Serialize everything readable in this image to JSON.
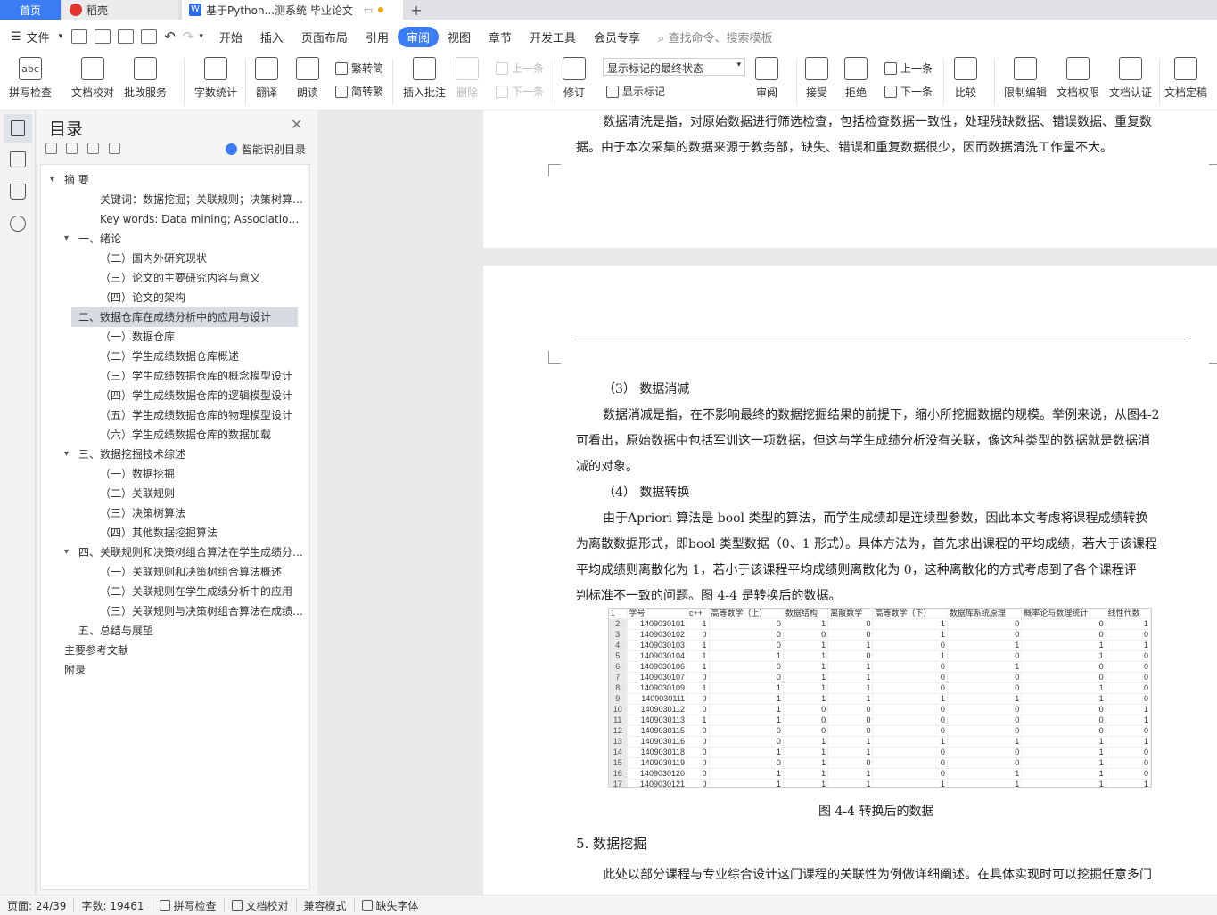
{
  "tabs": {
    "home": "首页",
    "daoke": "稻壳",
    "doc": "基于Python...测系统 毕业论文"
  },
  "menu": {
    "file": "文件",
    "items": [
      "开始",
      "插入",
      "页面布局",
      "引用",
      "审阅",
      "视图",
      "章节",
      "开发工具",
      "会员专享"
    ],
    "active": "审阅",
    "search_placeholder": "查找命令、搜索模板"
  },
  "ribbon": {
    "spellcheck": "拼写检查",
    "proofread": "文档校对",
    "correction_service": "批改服务",
    "word_count": "字数统计",
    "translate": "翻译",
    "read_aloud": "朗读",
    "trad_to_simp_a": "繁转简",
    "trad_to_simp_b": "简转繁",
    "insert_comment": "插入批注",
    "delete": "删除",
    "prev_comment": "上一条",
    "next_comment": "下一条",
    "revise": "修订",
    "track_state": "显示标记的最终状态",
    "show_markup": "显示标记",
    "review": "审阅",
    "accept": "接受",
    "reject": "拒绝",
    "prev_change": "上一条",
    "next_change": "下一条",
    "compare": "比较",
    "restrict_edit": "限制编辑",
    "doc_permission": "文档权限",
    "doc_cert": "文档认证",
    "doc_finalize": "文档定稿"
  },
  "toc": {
    "title": "目录",
    "smart": "智能识别目录",
    "items": [
      {
        "text": "摘  要",
        "level": 0,
        "arrow": true
      },
      {
        "text": "关键词：数据挖掘；关联规则；决策树算法；成绩分析",
        "level": 2
      },
      {
        "text": "Key words: Data mining; Association rules; Decision tree",
        "level": 2
      },
      {
        "text": "一、绪论",
        "level": 1,
        "arrow": true
      },
      {
        "text": "（二）国内外研究现状",
        "level": 2
      },
      {
        "text": "（三）论文的主要研究内容与意义",
        "level": 2
      },
      {
        "text": "（四）论文的架构",
        "level": 2
      },
      {
        "text": "二、数据仓库在成绩分析中的应用与设计",
        "level": 1,
        "arrow": true,
        "selected": true
      },
      {
        "text": "（一）数据仓库",
        "level": 2
      },
      {
        "text": "（二）学生成绩数据仓库概述",
        "level": 2
      },
      {
        "text": "（三）学生成绩数据仓库的概念模型设计",
        "level": 2
      },
      {
        "text": "（四）学生成绩数据仓库的逻辑模型设计",
        "level": 2
      },
      {
        "text": "（五）学生成绩数据仓库的物理模型设计",
        "level": 2
      },
      {
        "text": "（六）学生成绩数据仓库的数据加载",
        "level": 2
      },
      {
        "text": "三、数据挖掘技术综述",
        "level": 1,
        "arrow": true
      },
      {
        "text": "（一）数据挖掘",
        "level": 2
      },
      {
        "text": "（二）关联规则",
        "level": 2
      },
      {
        "text": "（三）决策树算法",
        "level": 2
      },
      {
        "text": "（四）其他数据挖掘算法",
        "level": 2
      },
      {
        "text": "四、关联规则和决策树组合算法在学生成绩分析中的应用",
        "level": 1,
        "arrow": true
      },
      {
        "text": "（一）关联规则和决策树组合算法概述",
        "level": 2
      },
      {
        "text": "（二）关联规则在学生成绩分析中的应用",
        "level": 2
      },
      {
        "text": "（三）关联规则与决策树组合算法在成绩分析中的应用",
        "level": 2
      },
      {
        "text": "五、总结与展望",
        "level": 1
      },
      {
        "text": "主要参考文献",
        "level": 0
      },
      {
        "text": "附录",
        "level": 0
      }
    ]
  },
  "doc": {
    "p1_line1": "数据清洗是指，对原始数据进行筛选检查，包括检查数据一致性，处理残缺数据、错误数据、重复数",
    "p1_line2": "据。由于本次采集的数据来源于教务部，缺失、错误和重复数据很少，因而数据清洗工作量不大。",
    "h3": "（3） 数据消减",
    "p2_line1": "数据消减是指，在不影响最终的数据挖掘结果的前提下，缩小所挖掘数据的规模。举例来说，从图4-2",
    "p2_line2": "可看出，原始数据中包括军训这一项数据，但这与学生成绩分析没有关联，像这种类型的数据就是数据消",
    "p2_line3": "减的对象。",
    "h4": "（4） 数据转换",
    "p3_line1": "由于Apriori 算法是 bool 类型的算法，而学生成绩却是连续型参数，因此本文考虑将课程成绩转换",
    "p3_line2": "为离散数据形式，即bool 类型数据（0、1 形式）。具体方法为，首先求出课程的平均成绩，若大于该课程",
    "p3_line3": "平均成绩则离散化为 1，若小于该课程平均成绩则离散化为 0，这种离散化的方式考虑到了各个课程评",
    "p3_line4": "判标准不一致的问题。图 4-4 是转换后的数据。",
    "caption": "图 4-4 转换后的数据",
    "h5": "5. 数据挖掘",
    "p4_line1": "此处以部分课程与专业综合设计这门课程的关联性为例做详细阐述。在具体实现时可以挖掘任意多门"
  },
  "figure": {
    "headers": [
      "学号",
      "c++",
      "高等数学（上）",
      "数据结构",
      "离散数学",
      "高等数学（下）",
      "数据库系统原理",
      "概率论与数理统计",
      "线性代数"
    ],
    "rows": [
      [
        "1409030101",
        "1",
        "0",
        "1",
        "0",
        "1",
        "0",
        "0",
        "1"
      ],
      [
        "1409030102",
        "0",
        "0",
        "0",
        "0",
        "1",
        "0",
        "0",
        "0"
      ],
      [
        "1409030103",
        "1",
        "0",
        "1",
        "1",
        "0",
        "1",
        "1",
        "1"
      ],
      [
        "1409030104",
        "1",
        "1",
        "1",
        "0",
        "1",
        "0",
        "1",
        "0"
      ],
      [
        "1409030106",
        "1",
        "0",
        "1",
        "1",
        "0",
        "1",
        "0",
        "0"
      ],
      [
        "1409030107",
        "0",
        "0",
        "1",
        "1",
        "0",
        "0",
        "0",
        "0"
      ],
      [
        "1409030109",
        "1",
        "1",
        "1",
        "1",
        "0",
        "0",
        "1",
        "0"
      ],
      [
        "1409030111",
        "0",
        "1",
        "1",
        "1",
        "1",
        "1",
        "1",
        "0"
      ],
      [
        "1409030112",
        "0",
        "1",
        "0",
        "0",
        "0",
        "0",
        "0",
        "1"
      ],
      [
        "1409030113",
        "1",
        "1",
        "0",
        "0",
        "0",
        "0",
        "0",
        "1"
      ],
      [
        "1409030115",
        "0",
        "0",
        "0",
        "0",
        "0",
        "0",
        "0",
        "0"
      ],
      [
        "1409030116",
        "0",
        "0",
        "1",
        "1",
        "1",
        "1",
        "1",
        "1"
      ],
      [
        "1409030118",
        "0",
        "1",
        "1",
        "1",
        "0",
        "0",
        "1",
        "0"
      ],
      [
        "1409030119",
        "0",
        "0",
        "1",
        "0",
        "0",
        "0",
        "1",
        "0"
      ],
      [
        "1409030120",
        "0",
        "1",
        "1",
        "1",
        "0",
        "1",
        "1",
        "0"
      ],
      [
        "1409030121",
        "0",
        "1",
        "1",
        "1",
        "1",
        "1",
        "1",
        "1"
      ]
    ]
  },
  "status": {
    "page": "页面: 24/39",
    "words": "字数: 19461",
    "spell": "拼写检查",
    "proof": "文档校对",
    "compat": "兼容模式",
    "missing_font": "缺失字体"
  }
}
